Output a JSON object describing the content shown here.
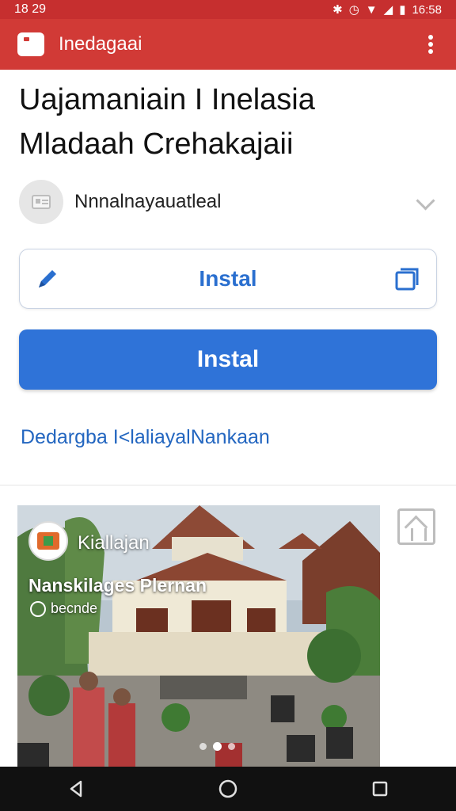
{
  "status_bar": {
    "left_time": "18 29",
    "right_time": "16:58",
    "icons": [
      "bluetooth-icon",
      "alarm-icon",
      "wifi-icon",
      "signal-icon",
      "battery-icon"
    ]
  },
  "app_bar": {
    "title": "Inedagaai",
    "icon": "app-logo-icon",
    "menu_icon": "more-vert-icon"
  },
  "headline": {
    "line1": "Uajamaniain I Inelasia",
    "line2": "Mladaah Crehakajaii"
  },
  "source": {
    "name": "Nnnalnayauatleal",
    "avatar_icon": "card-icon",
    "expand_icon": "chevron-down-icon"
  },
  "install_outline": {
    "label": "Instal",
    "left_icon": "pencil-icon",
    "right_icon": "copy-icon"
  },
  "install_primary": {
    "label": "Instal"
  },
  "link": {
    "text": "Dedargba I<laliayalNankaan"
  },
  "gallery": {
    "brand": "Kiallajan",
    "title": "Nanskilages Plernan",
    "subtitle": "becnde",
    "page_count": 3,
    "active_page": 2,
    "side_icon": "home-frame-icon"
  },
  "colors": {
    "app_bar": "#d13a36",
    "accent_blue": "#2f73d8",
    "link_blue": "#2366c0"
  },
  "nav": {
    "icons": [
      "back-icon",
      "home-icon",
      "recents-icon"
    ]
  }
}
